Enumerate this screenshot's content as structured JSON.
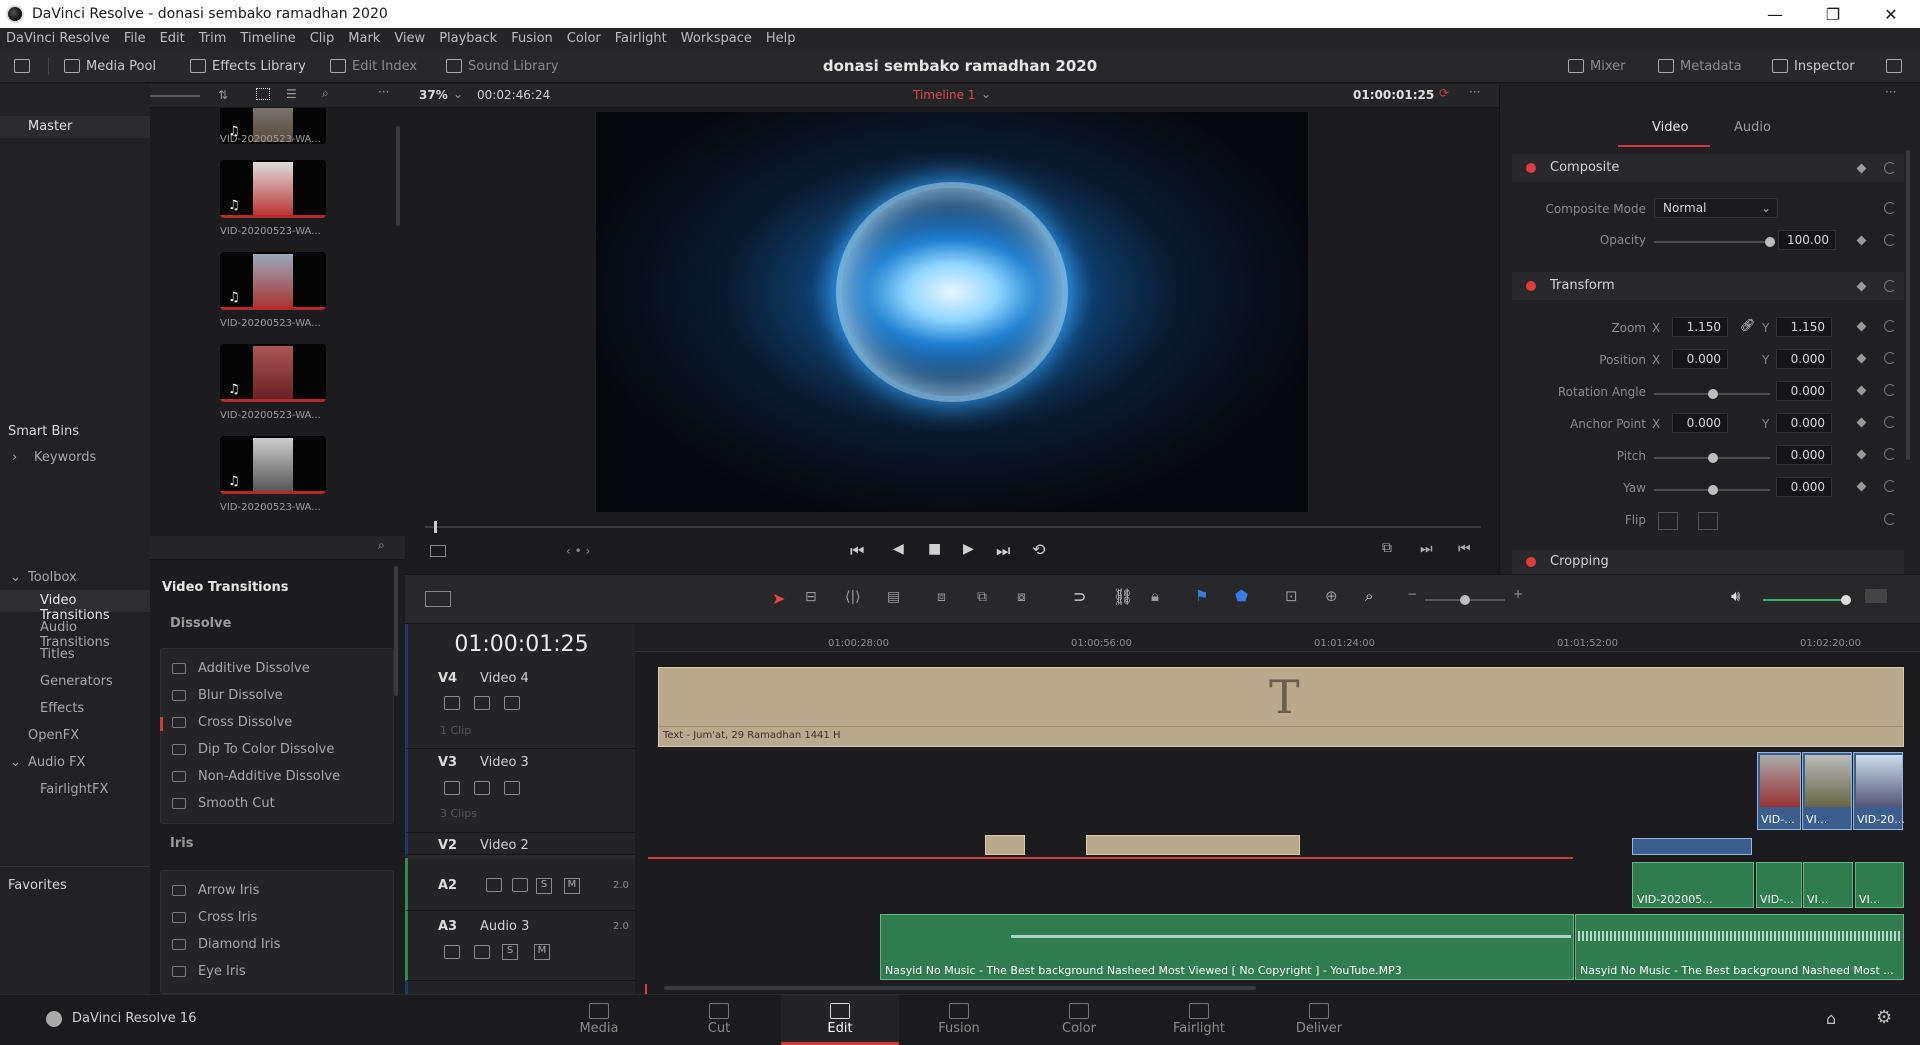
{
  "window": {
    "title": "DaVinci Resolve - donasi sembako ramadhan 2020",
    "controls": [
      "—",
      "❐",
      "✕"
    ]
  },
  "menu": [
    "DaVinci Resolve",
    "File",
    "Edit",
    "Trim",
    "Timeline",
    "Clip",
    "Mark",
    "View",
    "Playback",
    "Fusion",
    "Color",
    "Fairlight",
    "Workspace",
    "Help"
  ],
  "toolbar": {
    "media_pool": "Media Pool",
    "effects_library": "Effects Library",
    "edit_index": "Edit Index",
    "sound_library": "Sound Library",
    "project_title": "donasi sembako ramadhan 2020",
    "mixer": "Mixer",
    "metadata": "Metadata",
    "inspector": "Inspector"
  },
  "media_pool": {
    "bin_master": "Master",
    "smart_bins": "Smart Bins",
    "keywords": "Keywords",
    "more": "...",
    "clips": [
      "VID-20200523-WA...",
      "VID-20200523-WA...",
      "VID-20200523-WA...",
      "VID-20200523-WA...",
      "VID-20200523-WA..."
    ]
  },
  "viewer": {
    "zoom": "37%",
    "duration": "00:02:46:24",
    "timeline_name": "Timeline 1",
    "timecode": "01:00:01:25"
  },
  "inspector": {
    "tab_video": "Video",
    "tab_audio": "Audio",
    "composite": "Composite",
    "composite_mode_label": "Composite Mode",
    "composite_mode_value": "Normal",
    "opacity_label": "Opacity",
    "opacity_value": "100.00",
    "transform": "Transform",
    "zoom_label": "Zoom",
    "zoom_x": "1.150",
    "zoom_y": "1.150",
    "position_label": "Position",
    "position_x": "0.000",
    "position_y": "0.000",
    "rotation_label": "Rotation Angle",
    "rotation_value": "0.000",
    "anchor_label": "Anchor Point",
    "anchor_x": "0.000",
    "anchor_y": "0.000",
    "pitch_label": "Pitch",
    "pitch_value": "0.000",
    "yaw_label": "Yaw",
    "yaw_value": "0.000",
    "flip_label": "Flip",
    "cropping": "Cropping",
    "axis_x": "X",
    "axis_y": "Y"
  },
  "effects": {
    "toolbox": "Toolbox",
    "video_transitions": "Video Transitions",
    "audio_transitions": "Audio Transitions",
    "titles": "Titles",
    "generators": "Generators",
    "effects": "Effects",
    "openfx": "OpenFX",
    "audio_fx": "Audio FX",
    "fairlightfx": "FairlightFX",
    "favorites": "Favorites",
    "list_title": "Video Transitions",
    "dissolve": "Dissolve",
    "dissolve_items": [
      "Additive Dissolve",
      "Blur Dissolve",
      "Cross Dissolve",
      "Dip To Color Dissolve",
      "Non-Additive Dissolve",
      "Smooth Cut"
    ],
    "iris": "Iris",
    "iris_items": [
      "Arrow Iris",
      "Cross Iris",
      "Diamond Iris",
      "Eye Iris"
    ]
  },
  "timeline": {
    "timecode": "01:00:01:25",
    "ruler": [
      "01:00:28:00",
      "01:00:56:00",
      "01:01:24:00",
      "01:01:52:00",
      "01:02:20:00"
    ],
    "tracks": {
      "v4_id": "V4",
      "v4_name": "Video 4",
      "v4_sub": "1 Clip",
      "v3_id": "V3",
      "v3_name": "Video 3",
      "v3_sub": "3 Clips",
      "v2_id": "V2",
      "v2_name": "Video 2",
      "a2_id": "A2",
      "a2_level": "2.0",
      "a3_id": "A3",
      "a3_name": "Audio 3",
      "a3_level": "2.0",
      "solo": "S",
      "mute": "M"
    },
    "title_clip": "Text - Jum'at, 29 Ramadhan 1441 H",
    "title_glyph": "T",
    "v3_clips": [
      "VID-...",
      "VI...",
      "VID-20..."
    ],
    "a2_clips": [
      "VID-202005...",
      "VID-...",
      "VI...",
      "VI..."
    ],
    "audio_clip_1": "Nasyid No Music - The Best background Nasheed Most Viewed [ No Copyright ] - YouTube.MP3",
    "audio_clip_2": "Nasyid No Music - The Best background Nasheed Most ..."
  },
  "pages": [
    "Media",
    "Cut",
    "Edit",
    "Fusion",
    "Color",
    "Fairlight",
    "Deliver"
  ],
  "footer_app": "DaVinci Resolve 16",
  "colors": {
    "accent_red": "#e13b3b",
    "title_clip": "#b9aa8e",
    "audio_clip": "#2f7d4e"
  }
}
